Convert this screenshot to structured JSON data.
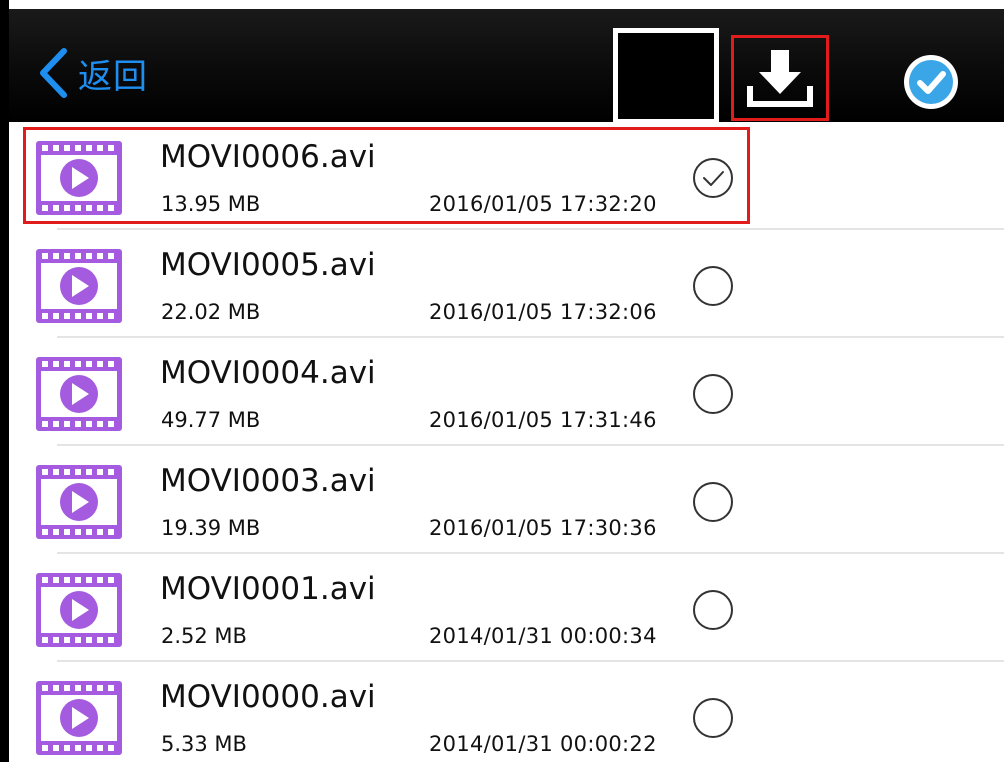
{
  "header": {
    "back_label": "返回",
    "icons": {
      "back": "chevron-left-icon",
      "download": "download-icon",
      "select_all": "check-circle-icon"
    },
    "colors": {
      "accent": "#1e8ff0",
      "highlight": "#e21b1b",
      "check_blue": "#3aa6e8"
    }
  },
  "files": [
    {
      "name": "MOVI0006.avi",
      "size": "13.95 MB",
      "date": "2016/01/05 17:32:20",
      "selected": true
    },
    {
      "name": "MOVI0005.avi",
      "size": "22.02 MB",
      "date": "2016/01/05 17:32:06",
      "selected": false
    },
    {
      "name": "MOVI0004.avi",
      "size": "49.77 MB",
      "date": "2016/01/05 17:31:46",
      "selected": false
    },
    {
      "name": "MOVI0003.avi",
      "size": "19.39 MB",
      "date": "2016/01/05 17:30:36",
      "selected": false
    },
    {
      "name": "MOVI0001.avi",
      "size": "2.52 MB",
      "date": "2014/01/31 00:00:34",
      "selected": false
    },
    {
      "name": "MOVI0000.avi",
      "size": "5.33 MB",
      "date": "2014/01/31 00:00:22",
      "selected": false
    }
  ],
  "file_icon": "video-file-icon",
  "file_icon_color": "#a45be0"
}
